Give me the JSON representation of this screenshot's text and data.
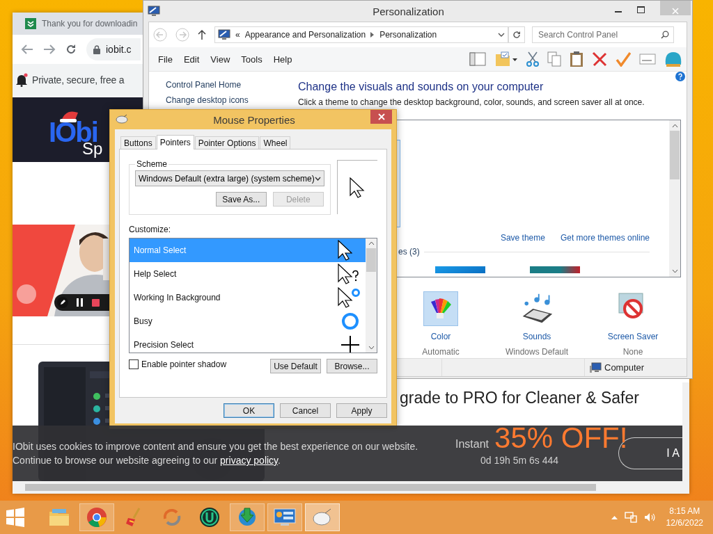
{
  "browser": {
    "tab_title": "Thank you for downloadin",
    "url": "iobit.c",
    "notification": "Private, secure, free a",
    "logo": "IObi",
    "logo_sub": "Sp",
    "promo": {
      "headline": "grade to PRO for Cleaner & Safer",
      "instant": "Instant",
      "discount": "35% OFF!",
      "countdown": "0d 19h 5m 6s 444"
    },
    "cookie": {
      "line_1": "IObit uses cookies to improve content and ensure you get the best experience on our website.",
      "line_2": "Continue to browse our website agreeing to our",
      "link": "privacy policy",
      "line_2_end": ".",
      "button": "I A"
    }
  },
  "personalization": {
    "title": "Personalization",
    "breadcrumb_prefix": "«",
    "breadcrumb": [
      "Appearance and Personalization",
      "Personalization"
    ],
    "search": {
      "placeholder": "Search Control Panel"
    },
    "menu": [
      "File",
      "Edit",
      "View",
      "Tools",
      "Help"
    ],
    "sidebar": [
      "Control Panel Home",
      "Change desktop icons"
    ],
    "heading": "Change the visuals and sounds on your computer",
    "description": "Click a theme to change the desktop background, color, sounds, and screen saver all at once.",
    "theme_links": [
      "Save theme",
      "Get more themes online"
    ],
    "group_label": "es (3)",
    "settings": [
      {
        "kind": "color",
        "label": "Color",
        "value": "Automatic",
        "selected": true
      },
      {
        "kind": "sounds",
        "label": "Sounds",
        "value": "Windows Default",
        "selected": false
      },
      {
        "kind": "screensaver",
        "label": "Screen Saver",
        "value": "None",
        "selected": false
      }
    ],
    "status": "Computer"
  },
  "mouse_properties": {
    "title": "Mouse Properties",
    "tabs": [
      {
        "label": "Buttons",
        "selected": false
      },
      {
        "label": "Pointers",
        "selected": true
      },
      {
        "label": "Pointer Options",
        "selected": false
      },
      {
        "label": "Wheel",
        "selected": false
      }
    ],
    "scheme": {
      "label": "Scheme",
      "value": "Windows Default (extra large) (system scheme)"
    },
    "scheme_buttons": [
      {
        "label": "Save As...",
        "disabled": false
      },
      {
        "label": "Delete",
        "disabled": true
      }
    ],
    "customize_label": "Customize:",
    "pointers": [
      {
        "name": "Normal Select",
        "kind": "arrow",
        "selected": true
      },
      {
        "name": "Help Select",
        "kind": "help",
        "selected": false
      },
      {
        "name": "Working In Background",
        "kind": "working",
        "selected": false
      },
      {
        "name": "Busy",
        "kind": "busy",
        "selected": false
      },
      {
        "name": "Precision Select",
        "kind": "precision",
        "selected": false
      }
    ],
    "pointer_shadow": {
      "label": "Enable pointer shadow",
      "checked": false
    },
    "list_buttons": [
      "Use Default",
      "Browse..."
    ],
    "buttons": [
      "OK",
      "Cancel",
      "Apply"
    ]
  },
  "taskbar": {
    "apps": [
      {
        "kind": "explorer",
        "open": false,
        "active": false
      },
      {
        "kind": "chrome",
        "open": true,
        "active": false
      },
      {
        "kind": "broom",
        "open": false,
        "active": false
      },
      {
        "kind": "sync",
        "open": false,
        "active": false
      },
      {
        "kind": "uninstaller",
        "open": false,
        "active": false
      },
      {
        "kind": "downloader",
        "open": true,
        "active": false
      },
      {
        "kind": "control",
        "open": true,
        "active": false
      },
      {
        "kind": "mouse",
        "open": true,
        "active": true
      }
    ],
    "time": "8:15 AM",
    "date": "12/6/2022"
  }
}
